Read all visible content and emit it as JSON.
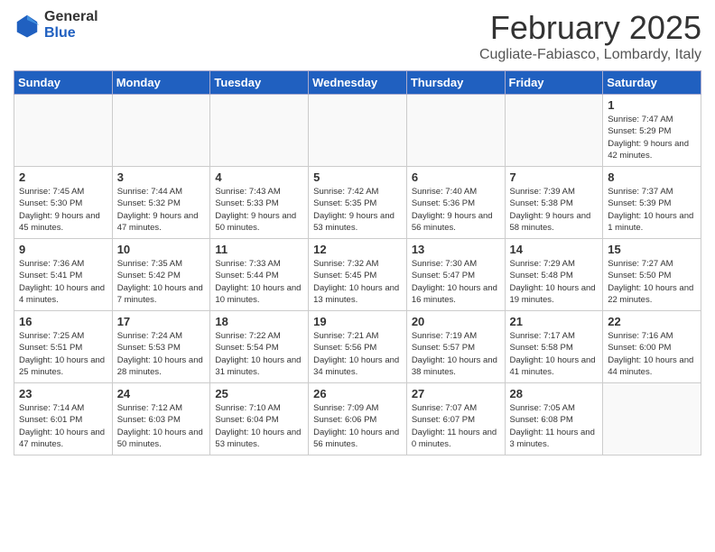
{
  "header": {
    "logo_general": "General",
    "logo_blue": "Blue",
    "month_title": "February 2025",
    "location": "Cugliate-Fabiasco, Lombardy, Italy"
  },
  "weekdays": [
    "Sunday",
    "Monday",
    "Tuesday",
    "Wednesday",
    "Thursday",
    "Friday",
    "Saturday"
  ],
  "weeks": [
    [
      {
        "day": "",
        "text": "",
        "empty": true
      },
      {
        "day": "",
        "text": "",
        "empty": true
      },
      {
        "day": "",
        "text": "",
        "empty": true
      },
      {
        "day": "",
        "text": "",
        "empty": true
      },
      {
        "day": "",
        "text": "",
        "empty": true
      },
      {
        "day": "",
        "text": "",
        "empty": true
      },
      {
        "day": "1",
        "text": "Sunrise: 7:47 AM\nSunset: 5:29 PM\nDaylight: 9 hours and 42 minutes."
      }
    ],
    [
      {
        "day": "2",
        "text": "Sunrise: 7:45 AM\nSunset: 5:30 PM\nDaylight: 9 hours and 45 minutes."
      },
      {
        "day": "3",
        "text": "Sunrise: 7:44 AM\nSunset: 5:32 PM\nDaylight: 9 hours and 47 minutes."
      },
      {
        "day": "4",
        "text": "Sunrise: 7:43 AM\nSunset: 5:33 PM\nDaylight: 9 hours and 50 minutes."
      },
      {
        "day": "5",
        "text": "Sunrise: 7:42 AM\nSunset: 5:35 PM\nDaylight: 9 hours and 53 minutes."
      },
      {
        "day": "6",
        "text": "Sunrise: 7:40 AM\nSunset: 5:36 PM\nDaylight: 9 hours and 56 minutes."
      },
      {
        "day": "7",
        "text": "Sunrise: 7:39 AM\nSunset: 5:38 PM\nDaylight: 9 hours and 58 minutes."
      },
      {
        "day": "8",
        "text": "Sunrise: 7:37 AM\nSunset: 5:39 PM\nDaylight: 10 hours and 1 minute."
      }
    ],
    [
      {
        "day": "9",
        "text": "Sunrise: 7:36 AM\nSunset: 5:41 PM\nDaylight: 10 hours and 4 minutes."
      },
      {
        "day": "10",
        "text": "Sunrise: 7:35 AM\nSunset: 5:42 PM\nDaylight: 10 hours and 7 minutes."
      },
      {
        "day": "11",
        "text": "Sunrise: 7:33 AM\nSunset: 5:44 PM\nDaylight: 10 hours and 10 minutes."
      },
      {
        "day": "12",
        "text": "Sunrise: 7:32 AM\nSunset: 5:45 PM\nDaylight: 10 hours and 13 minutes."
      },
      {
        "day": "13",
        "text": "Sunrise: 7:30 AM\nSunset: 5:47 PM\nDaylight: 10 hours and 16 minutes."
      },
      {
        "day": "14",
        "text": "Sunrise: 7:29 AM\nSunset: 5:48 PM\nDaylight: 10 hours and 19 minutes."
      },
      {
        "day": "15",
        "text": "Sunrise: 7:27 AM\nSunset: 5:50 PM\nDaylight: 10 hours and 22 minutes."
      }
    ],
    [
      {
        "day": "16",
        "text": "Sunrise: 7:25 AM\nSunset: 5:51 PM\nDaylight: 10 hours and 25 minutes."
      },
      {
        "day": "17",
        "text": "Sunrise: 7:24 AM\nSunset: 5:53 PM\nDaylight: 10 hours and 28 minutes."
      },
      {
        "day": "18",
        "text": "Sunrise: 7:22 AM\nSunset: 5:54 PM\nDaylight: 10 hours and 31 minutes."
      },
      {
        "day": "19",
        "text": "Sunrise: 7:21 AM\nSunset: 5:56 PM\nDaylight: 10 hours and 34 minutes."
      },
      {
        "day": "20",
        "text": "Sunrise: 7:19 AM\nSunset: 5:57 PM\nDaylight: 10 hours and 38 minutes."
      },
      {
        "day": "21",
        "text": "Sunrise: 7:17 AM\nSunset: 5:58 PM\nDaylight: 10 hours and 41 minutes."
      },
      {
        "day": "22",
        "text": "Sunrise: 7:16 AM\nSunset: 6:00 PM\nDaylight: 10 hours and 44 minutes."
      }
    ],
    [
      {
        "day": "23",
        "text": "Sunrise: 7:14 AM\nSunset: 6:01 PM\nDaylight: 10 hours and 47 minutes."
      },
      {
        "day": "24",
        "text": "Sunrise: 7:12 AM\nSunset: 6:03 PM\nDaylight: 10 hours and 50 minutes."
      },
      {
        "day": "25",
        "text": "Sunrise: 7:10 AM\nSunset: 6:04 PM\nDaylight: 10 hours and 53 minutes."
      },
      {
        "day": "26",
        "text": "Sunrise: 7:09 AM\nSunset: 6:06 PM\nDaylight: 10 hours and 56 minutes."
      },
      {
        "day": "27",
        "text": "Sunrise: 7:07 AM\nSunset: 6:07 PM\nDaylight: 11 hours and 0 minutes."
      },
      {
        "day": "28",
        "text": "Sunrise: 7:05 AM\nSunset: 6:08 PM\nDaylight: 11 hours and 3 minutes."
      },
      {
        "day": "",
        "text": "",
        "empty": true
      }
    ]
  ]
}
